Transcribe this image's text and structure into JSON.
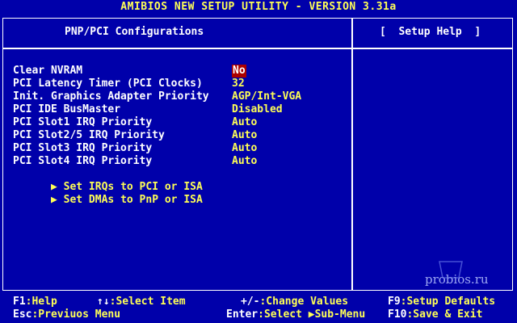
{
  "title": "AMIBIOS NEW SETUP UTILITY - VERSION 3.31a",
  "main_panel": {
    "header": "PNP/PCI Configurations"
  },
  "help_panel": {
    "header": "[  Setup Help  ]"
  },
  "settings": [
    {
      "label": "Clear NVRAM",
      "value": "No",
      "selected": true
    },
    {
      "label": "PCI Latency Timer (PCI Clocks)",
      "value": "32"
    },
    {
      "label": "Init. Graphics Adapter Priority",
      "value": "AGP/Int-VGA"
    },
    {
      "label": "PCI IDE BusMaster",
      "value": "Disabled"
    },
    {
      "label": "PCI Slot1 IRQ Priority",
      "value": "Auto"
    },
    {
      "label": "PCI Slot2/5 IRQ Priority",
      "value": "Auto"
    },
    {
      "label": "PCI Slot3 IRQ Priority",
      "value": "Auto"
    },
    {
      "label": "PCI Slot4 IRQ Priority",
      "value": "Auto"
    }
  ],
  "submenus": [
    {
      "label": "Set IRQs to PCI or ISA"
    },
    {
      "label": "Set DMAs to PnP or ISA"
    }
  ],
  "watermark": "probios.ru",
  "footer": {
    "help_key": "F1",
    "help_text": ":Help",
    "select_item_key": "↑↓",
    "select_item_text": ":Select Item",
    "change_key": "+/-",
    "change_text": ":Change Values",
    "defaults_key": "F9",
    "defaults_text": ":Setup Defaults",
    "esc_key": "Esc",
    "esc_text": ":Previuos Menu",
    "enter_key": "Enter",
    "enter_text": ":Select ▶Sub-Menu",
    "save_key": "F10",
    "save_text": ":Save & Exit"
  },
  "colors": {
    "background": "#0000aa",
    "highlight": "#ffff55",
    "selection": "#aa0000",
    "frame": "#ffffff"
  }
}
